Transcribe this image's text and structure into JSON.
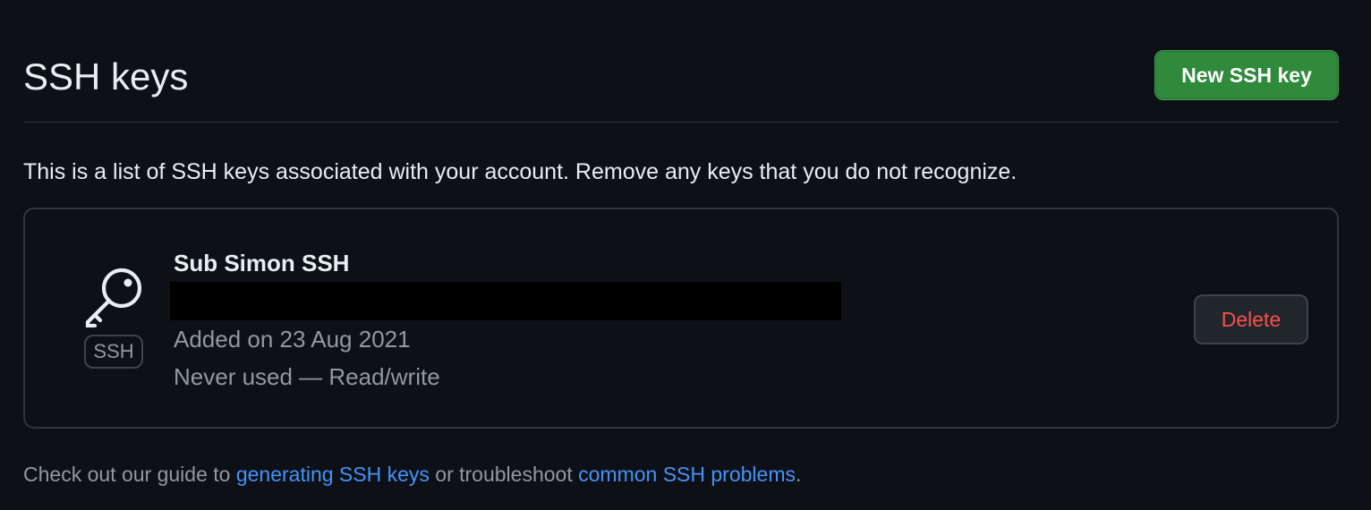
{
  "header": {
    "title": "SSH keys",
    "new_key_label": "New SSH key",
    "new_key_color": "#2f8a3b"
  },
  "description": "This is a list of SSH keys associated with your account. Remove any keys that you do not recognize.",
  "keys": [
    {
      "icon": "key-icon",
      "type_badge": "SSH",
      "title": "Sub Simon SSH",
      "fingerprint": "",
      "added": "Added on 23 Aug 2021",
      "usage": "Never used — Read/write",
      "delete_label": "Delete",
      "delete_color": "#f85149"
    }
  ],
  "footer": {
    "prefix": "Check out our guide to ",
    "link1": "generating SSH keys",
    "middle": " or troubleshoot ",
    "link2": "common SSH problems",
    "suffix": ".",
    "link_color": "#4493f8"
  }
}
